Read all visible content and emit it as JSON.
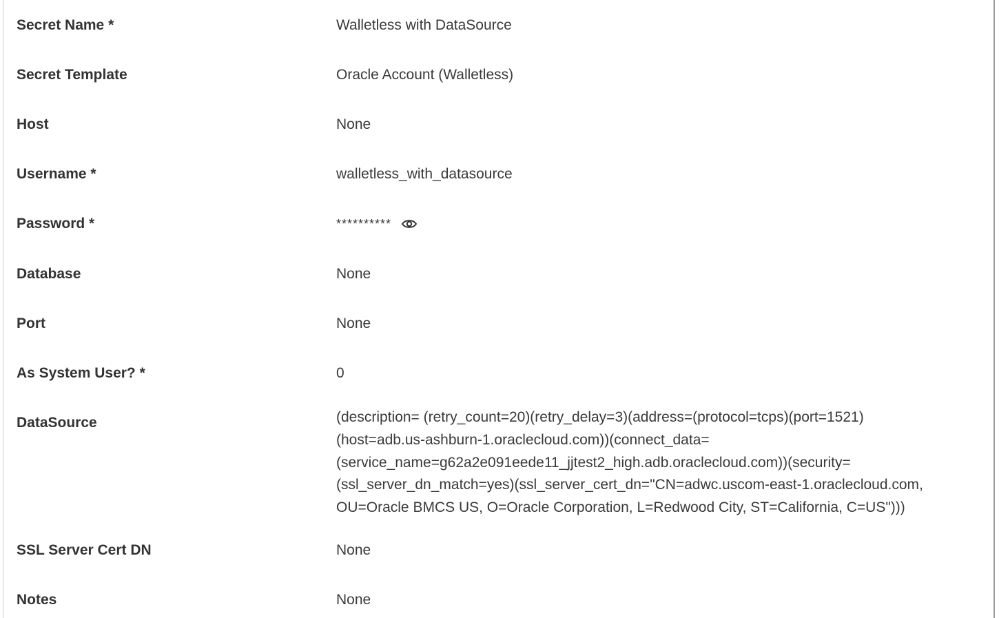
{
  "fields": [
    {
      "label": "Secret Name *",
      "value": "Walletless with DataSource"
    },
    {
      "label": "Secret Template",
      "value": "Oracle Account (Walletless)"
    },
    {
      "label": "Host",
      "value": "None"
    },
    {
      "label": "Username *",
      "value": "walletless_with_datasource"
    },
    {
      "label": "Password *",
      "value": "**********",
      "icon": "eye-icon"
    },
    {
      "label": "Database",
      "value": "None"
    },
    {
      "label": "Port",
      "value": "None"
    },
    {
      "label": "As System User? *",
      "value": "0"
    },
    {
      "label": "DataSource",
      "lines": [
        "(description= (retry_count=20)(retry_delay=3)(address=(protocol=tcps)(port=1521)",
        "(host=adb.us-ashburn-1.oraclecloud.com))(connect_data=",
        "(service_name=g62a2e091eede11_jjtest2_high.adb.oraclecloud.com))(security=",
        "(ssl_server_dn_match=yes)(ssl_server_cert_dn=\"CN=adwc.uscom-east-1.oraclecloud.com,",
        "OU=Oracle BMCS US, O=Oracle Corporation, L=Redwood City, ST=California, C=US\")))"
      ]
    },
    {
      "label": "SSL Server Cert DN",
      "value": "None"
    },
    {
      "label": "Notes",
      "value": "None"
    }
  ]
}
